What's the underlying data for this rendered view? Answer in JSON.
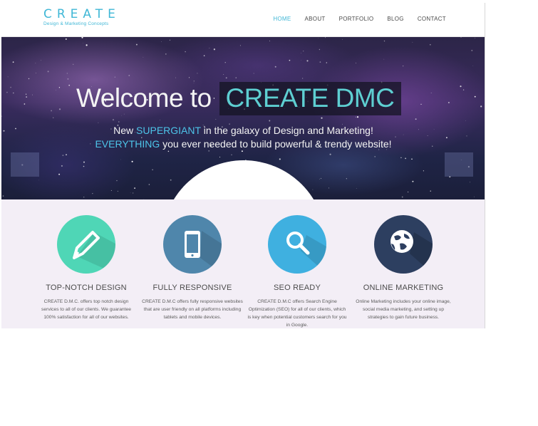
{
  "logo": {
    "title": "CREATE",
    "subtitle": "Design & Marketing Concepts"
  },
  "nav": [
    {
      "label": "HOME",
      "active": true
    },
    {
      "label": "ABOUT"
    },
    {
      "label": "PORTFOLIO"
    },
    {
      "label": "BLOG"
    },
    {
      "label": "CONTACT"
    }
  ],
  "hero": {
    "title_prefix": "Welcome to ",
    "title_highlight": "CREATE DMC",
    "line1_prefix": "New ",
    "line1_accent": "SUPERGIANT",
    "line1_suffix": " in the galaxy of Design and Marketing!",
    "line2_accent": "EVERYTHING",
    "line2_suffix": " you ever needed to build powerful & trendy website!"
  },
  "features": [
    {
      "title": "TOP-NOTCH DESIGN",
      "icon": "pencil-icon",
      "color": "#4fd6b6",
      "desc": "CREATE D.M.C. offers top notch design services to all of our clients. We guarantee 100% satisfaction for all of our websites."
    },
    {
      "title": "FULLY RESPONSIVE",
      "icon": "tablet-icon",
      "color": "#4f86ab",
      "desc": "CREATE D.M.C offers fully responsive websites that are user friendly on all platforms including tablets and mobile devices."
    },
    {
      "title": "SEO READY",
      "icon": "magnifier-icon",
      "color": "#3fb0e0",
      "desc": "CREATE D.M.C offers Search Engine Optimization (SEO) for all of our clients, which is key when potential customers search for you in Google."
    },
    {
      "title": "ONLINE MARKETING",
      "icon": "globe-icon",
      "color": "#2d3f60",
      "desc": "Online Marketing includes your online image, social media marketing, and setting up strategies to gain future business."
    }
  ]
}
